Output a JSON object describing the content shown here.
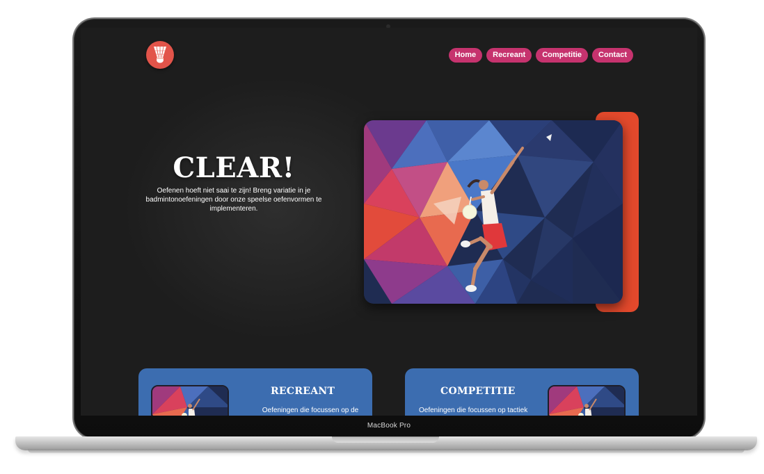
{
  "device": {
    "model_label": "MacBook Pro"
  },
  "site": {
    "logo_icon": "shuttlecock-icon",
    "nav": [
      {
        "label": "Home"
      },
      {
        "label": "Recreant"
      },
      {
        "label": "Competitie"
      },
      {
        "label": "Contact"
      }
    ],
    "hero": {
      "title": "CLEAR!",
      "text": "Oefenen hoeft niet saai te zijn! Breng variatie in je badmintonoefeningen door onze speelse oefenvormen te implementeren.",
      "image_icon": "badminton-player-illustration"
    },
    "cards": [
      {
        "title": "RECREANT",
        "text": "Oefeningen die focussen op de"
      },
      {
        "title": "COMPETITIE",
        "text": "Oefeningen die focussen op tactiek"
      }
    ],
    "colors": {
      "background": "#1d1d1d",
      "nav_button": "#c6336e",
      "logo": "#e2544a",
      "hero_accent": "#e3492c",
      "card": "#3c6db0"
    }
  }
}
